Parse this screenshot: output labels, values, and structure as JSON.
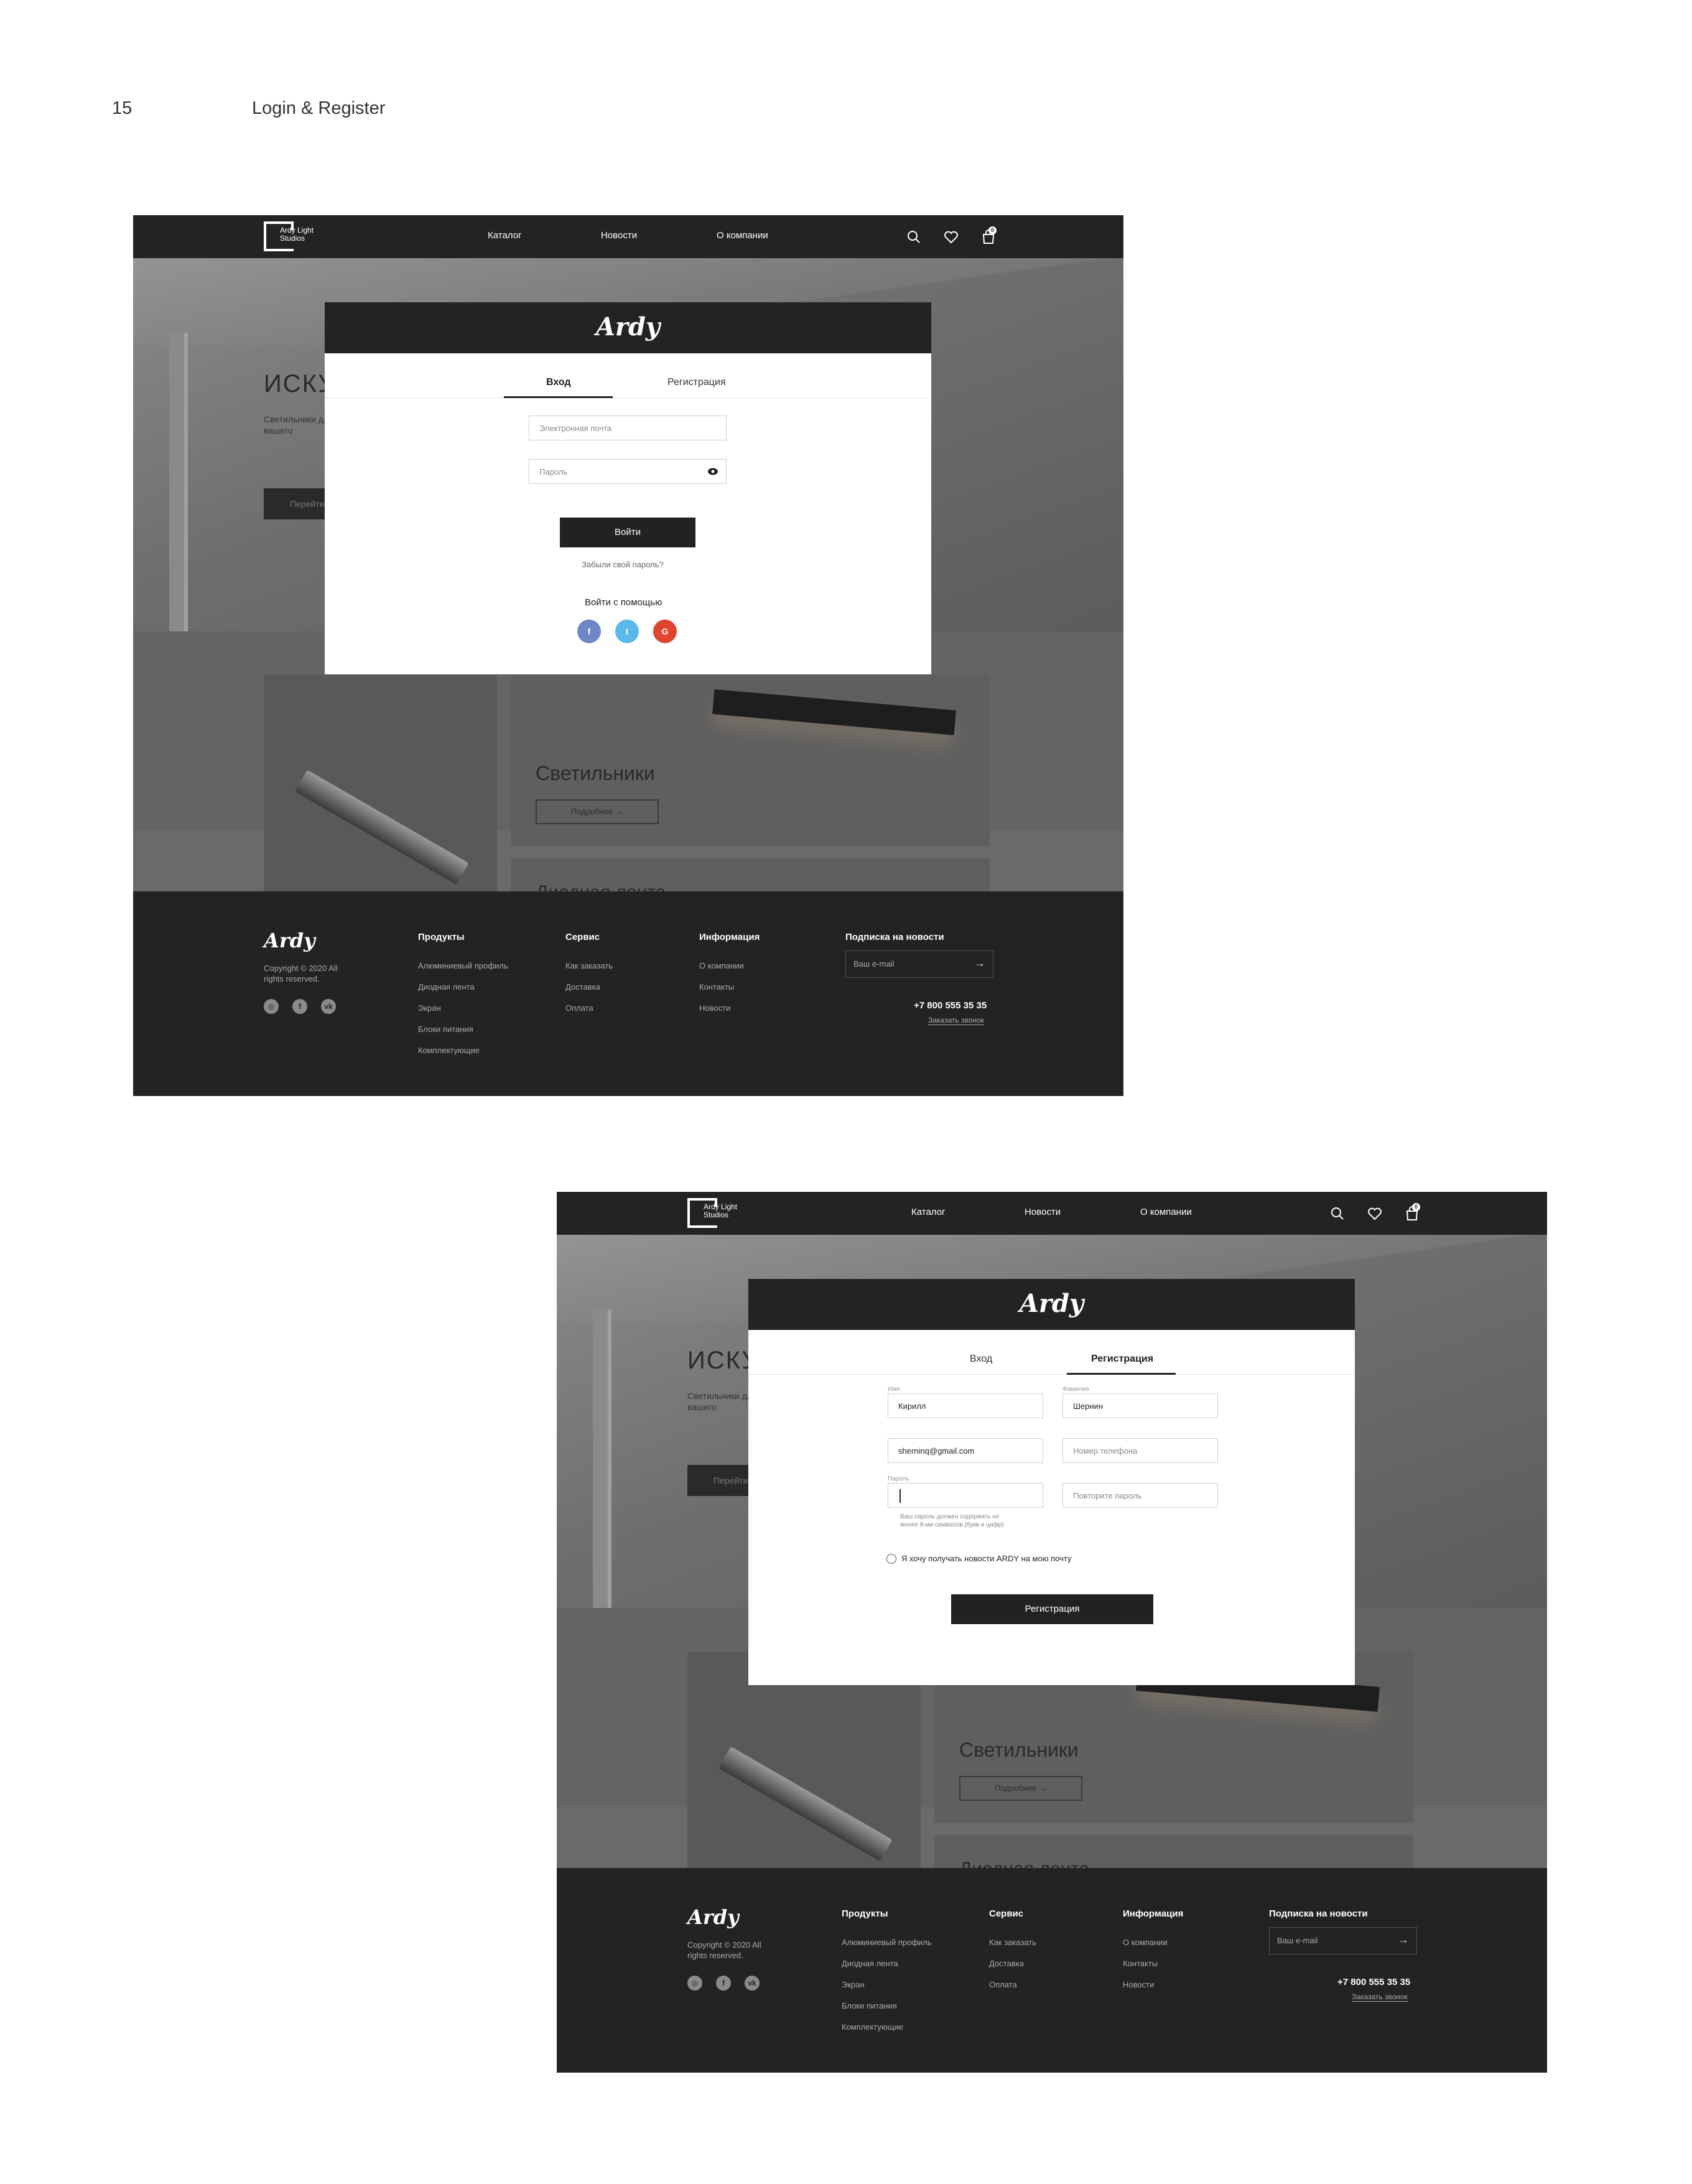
{
  "page": {
    "number": "15",
    "title": "Login & Register"
  },
  "header": {
    "logo_text": "Ardy Light Studios",
    "nav": [
      "Каталог",
      "Новости",
      "О компании"
    ],
    "cart_count": "0",
    "icons": [
      "search-icon",
      "heart-icon",
      "cart-icon"
    ]
  },
  "hero": {
    "title": "ИСКУ",
    "subtitle": "Светильники для вашего",
    "button": "Перейти"
  },
  "cards": {
    "lamps_title": "Светильники",
    "more_button": "Подробнее →",
    "led_tape": "Диодная лента"
  },
  "footer": {
    "logo": "Ardy",
    "copyright": "Copyright © 2020 All rights reserved.",
    "social": [
      "instagram-icon",
      "facebook-icon",
      "vk-icon"
    ],
    "products_title": "Продукты",
    "products": [
      "Алюминиевый профиль",
      "Диодная лента",
      "Экран",
      "Блоки питания",
      "Комплектующие"
    ],
    "service_title": "Сервис",
    "service": [
      "Как заказать",
      "Доставка",
      "Оплата"
    ],
    "info_title": "Информация",
    "info": [
      "О компании",
      "Контакты",
      "Новости"
    ],
    "subscribe_title": "Подписка на новости",
    "email_placeholder": "Ваш e-mail",
    "phone": "+7 800 555 35 35",
    "callback": "Заказать звонок"
  },
  "login": {
    "logo": "Ardy",
    "tab_login": "Вход",
    "tab_register": "Регистрация",
    "email_placeholder": "Электронная почта",
    "password_placeholder": "Пароль",
    "submit": "Войти",
    "forgot": "Забыли свой пароль?",
    "social_title": "Войти с помощью",
    "social": [
      "f",
      "t",
      "G"
    ],
    "social_colors": [
      "#6d86c6",
      "#5ab8ea",
      "#e0442f"
    ]
  },
  "register": {
    "logo": "Ardy",
    "tab_login": "Вход",
    "tab_register": "Регистрация",
    "first_name_label": "Имя",
    "first_name_value": "Кирилл",
    "last_name_label": "Фамилия",
    "last_name_value": "Шернин",
    "email_value": "sherninq@gmail.com",
    "phone_placeholder": "Номер телефона",
    "password_label": "Пароль",
    "repeat_placeholder": "Повторите пароль",
    "password_hint": "Ваш пароль должен содержать не менее 8-ми символов (букв и цифр)",
    "newsletter_label": "Я хочу получать новости ARDY на мою почту",
    "submit": "Регистрация"
  }
}
